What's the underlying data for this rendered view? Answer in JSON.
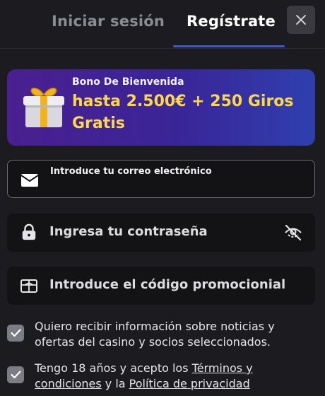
{
  "tabs": {
    "login": "Iniciar sesión",
    "register": "Regístrate"
  },
  "banner": {
    "subtitle": "Bono De Bienvenida",
    "title": "hasta 2.500€ + 250 Giros Gratis"
  },
  "form": {
    "email_placeholder": "Introduce tu correo electrónico",
    "password_placeholder": "Ingresa tu contraseña",
    "promo_placeholder": "Introduce el código promocionial"
  },
  "consent": {
    "marketing": "Quiero recibir información sobre noticias y ofertas del casino y socios seleccionados.",
    "age_prefix": "Tengo 18 años y acepto los ",
    "terms_link": "Términos y condiciones",
    "age_middle": " y la ",
    "privacy_link": "Política de privacidad"
  },
  "colors": {
    "accent": "#3f57d6",
    "bonus_text": "#ffd84a",
    "banner_start": "#4a1f90",
    "banner_end": "#2f3fae"
  },
  "icons": [
    "close-icon",
    "gift-icon",
    "envelope-icon",
    "lock-icon",
    "eye-off-icon",
    "ticket-icon",
    "check-icon"
  ]
}
